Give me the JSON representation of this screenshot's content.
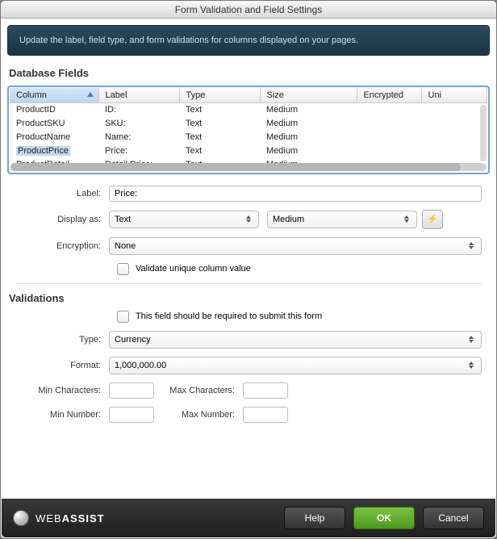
{
  "window": {
    "title": "Form Validation and Field Settings"
  },
  "infobar": "Update the label, field type, and form validations for columns displayed on your pages.",
  "section_db": "Database Fields",
  "table": {
    "headers": {
      "column": "Column",
      "label": "Label",
      "type": "Type",
      "size": "Size",
      "encrypted": "Encrypted",
      "unique": "Uni"
    },
    "rows": [
      {
        "column": "ProductID",
        "label": "ID:",
        "type": "Text",
        "size": "Medium",
        "selected": false
      },
      {
        "column": "ProductSKU",
        "label": "SKU:",
        "type": "Text",
        "size": "Medium",
        "selected": false
      },
      {
        "column": "ProductName",
        "label": "Name:",
        "type": "Text",
        "size": "Medium",
        "selected": false
      },
      {
        "column": "ProductPrice",
        "label": "Price:",
        "type": "Text",
        "size": "Medium",
        "selected": true
      },
      {
        "column": "ProductRetail…",
        "label": "Retail Price:",
        "type": "Text",
        "size": "Medium",
        "selected": false
      }
    ]
  },
  "form": {
    "label_lbl": "Label:",
    "label_value": "Price:",
    "display_as_lbl": "Display as:",
    "display_as_value": "Text",
    "display_size_value": "Medium",
    "encryption_lbl": "Encryption:",
    "encryption_value": "None",
    "unique_lbl": "Validate unique column value"
  },
  "section_validations": "Validations",
  "validations": {
    "required_lbl": "This field should be required to submit this form",
    "type_lbl": "Type:",
    "type_value": "Currency",
    "format_lbl": "Format:",
    "format_value": "1,000,000.00",
    "min_chars_lbl": "Min Characters:",
    "max_chars_lbl": "Max Characters:",
    "min_num_lbl": "Min Number:",
    "max_num_lbl": "Max Number:",
    "min_chars_value": "",
    "max_chars_value": "",
    "min_num_value": "",
    "max_num_value": ""
  },
  "footer": {
    "brand_light": "WEB",
    "brand_bold": "ASSIST",
    "help": "Help",
    "ok": "OK",
    "cancel": "Cancel"
  }
}
